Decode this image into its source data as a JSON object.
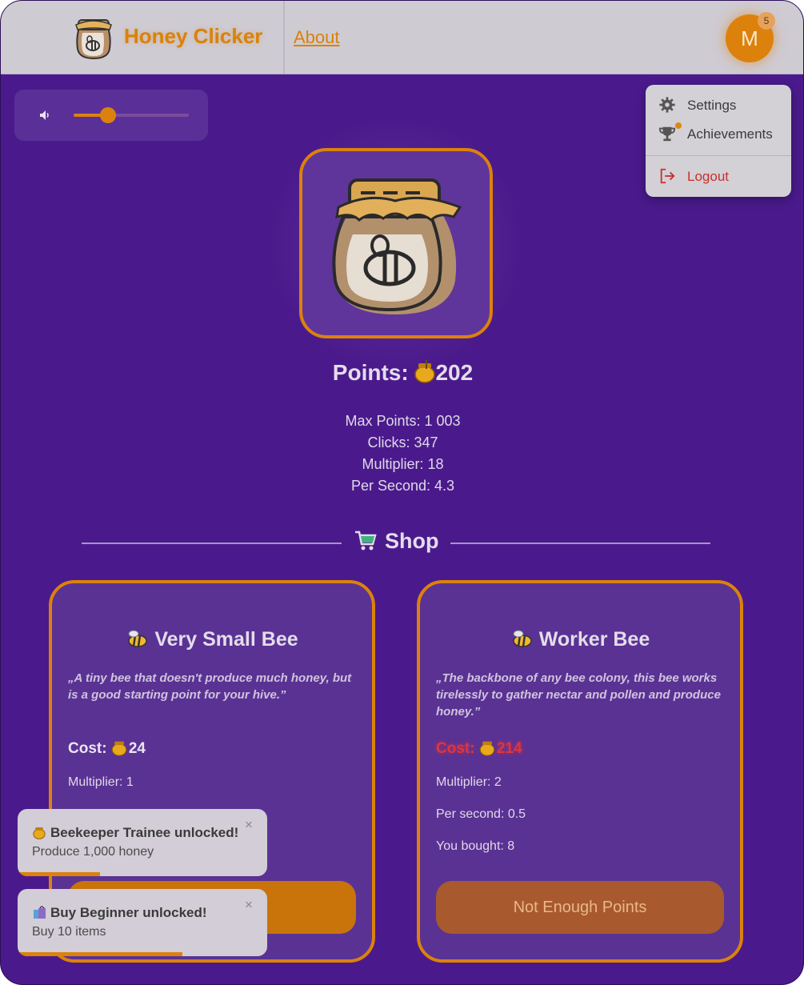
{
  "header": {
    "brand": "Honey Clicker",
    "about_link": "About",
    "avatar_initial": "M",
    "notification_count": "5"
  },
  "user_menu": {
    "items": [
      {
        "label": "Settings",
        "icon": "gear-icon"
      },
      {
        "label": "Achievements",
        "icon": "trophy-icon"
      },
      {
        "label": "Logout",
        "icon": "logout-icon"
      }
    ]
  },
  "volume": {
    "level": 0.3,
    "icon": "speaker-icon"
  },
  "game": {
    "points_label": "Points:",
    "points_value": "202",
    "stats": [
      "Max Points: 1 003",
      "Clicks: 347",
      "Multiplier: 18",
      "Per Second: 4.3"
    ]
  },
  "shop": {
    "title": "Shop",
    "items": [
      {
        "name": "Very Small Bee",
        "description": "„A tiny bee that doesn't produce much honey, but is a good starting point for your hive.”",
        "cost_label": "Cost:",
        "cost_value": "24",
        "multiplier": "Multiplier: 1",
        "button": ""
      },
      {
        "name": "Worker Bee",
        "description": "„The backbone of any bee colony, this bee works tirelessly to gather nectar and pollen and produce honey.”",
        "cost_label": "Cost:",
        "cost_value": "214",
        "multiplier": "Multiplier: 2",
        "per_second": "Per second: 0.5",
        "bought": "You bought: 8",
        "button": "Not Enough Points"
      }
    ]
  },
  "toasts": [
    {
      "title": "Beekeeper Trainee unlocked!",
      "text": "Produce 1,000 honey",
      "close": "×",
      "progress": 0.33
    },
    {
      "title": "Buy Beginner unlocked!",
      "text": "Buy 10 items",
      "close": "×",
      "progress": 0.66
    }
  ],
  "colors": {
    "accent": "#dc820c",
    "background": "#4a1a8c",
    "danger": "#e0353a"
  }
}
